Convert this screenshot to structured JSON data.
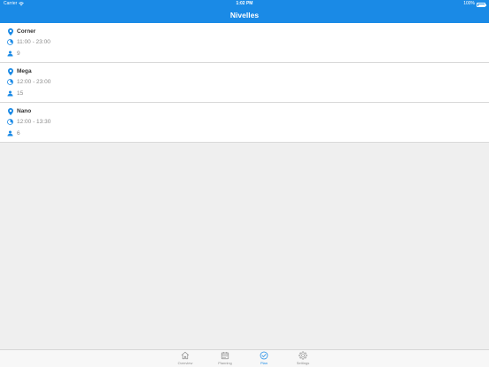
{
  "status_bar": {
    "carrier": "Carrier",
    "time": "1:02 PM",
    "battery": "100%"
  },
  "header": {
    "title": "Nivelles"
  },
  "colors": {
    "accent": "#1a8ae6",
    "muted_text": "#8a8a8a"
  },
  "rooms": [
    {
      "name": "Corner",
      "hours": "11:00 - 23:00",
      "capacity": "9"
    },
    {
      "name": "Mega",
      "hours": "12:00 - 23:00",
      "capacity": "15"
    },
    {
      "name": "Nano",
      "hours": "12:00 - 13:30",
      "capacity": "6"
    }
  ],
  "tabbar": {
    "items": [
      {
        "label": "Overview",
        "icon": "home-icon",
        "active": false
      },
      {
        "label": "Planning",
        "icon": "calendar-icon",
        "active": false
      },
      {
        "label": "Plan",
        "icon": "check-circle-icon",
        "active": true
      },
      {
        "label": "Settings",
        "icon": "gear-icon",
        "active": false
      }
    ]
  }
}
